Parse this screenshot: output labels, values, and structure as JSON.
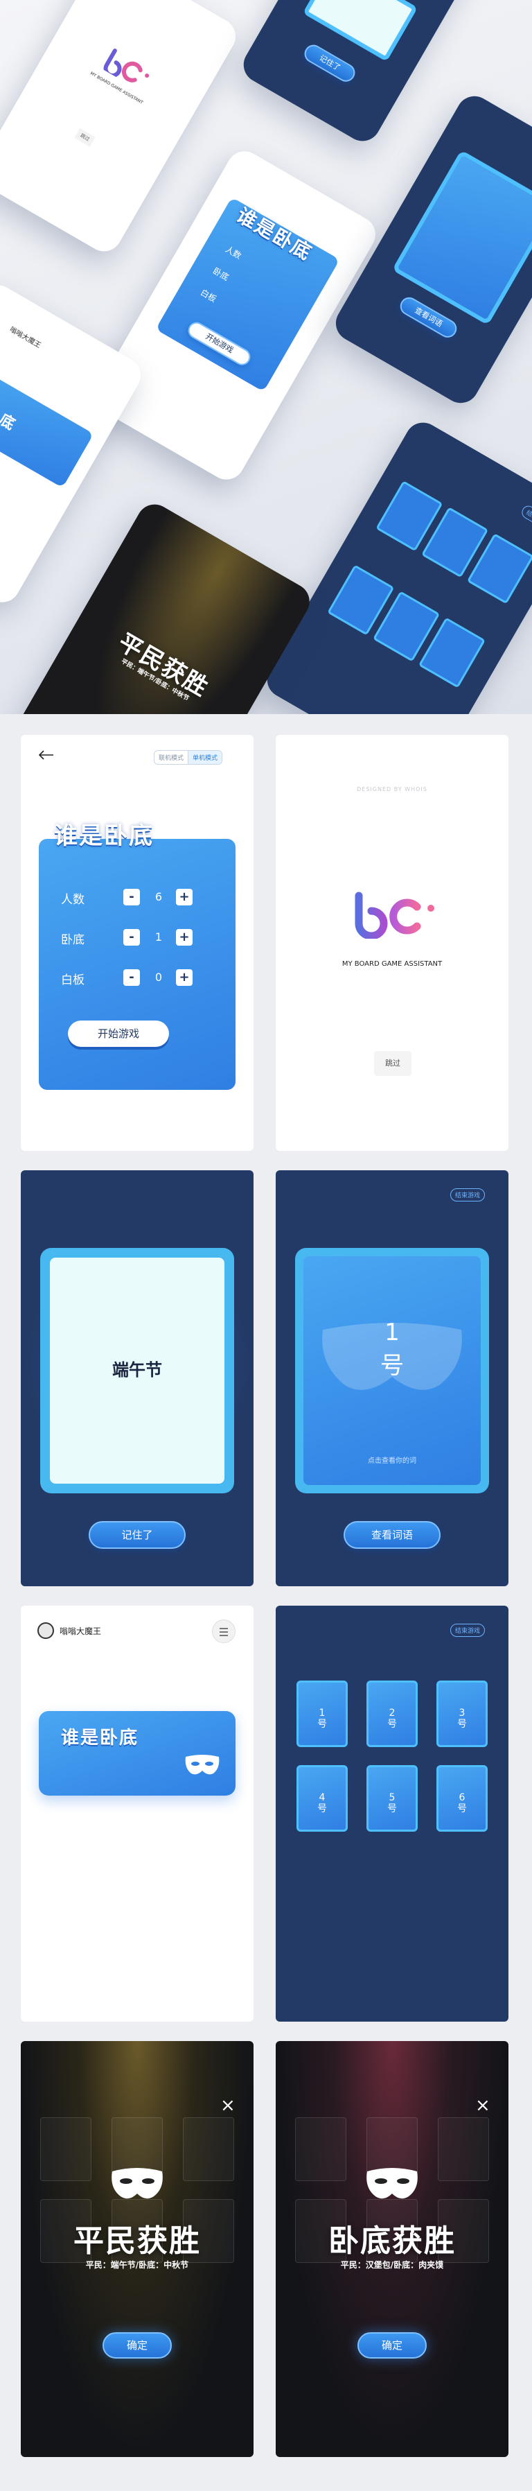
{
  "colors": {
    "navy": "#233a66",
    "blue": "#2f7fe3",
    "cyan": "#4fc0ff",
    "bg": "#eceef2"
  },
  "app": {
    "title": "谁是卧底",
    "tagline": "MY BOARD GAME ASSISTANT",
    "designed_by": "DESIGNED BY WHOIS"
  },
  "mode_tabs": [
    "联机模式",
    "单机模式"
  ],
  "settings": {
    "rows": [
      {
        "label": "人数",
        "minus": "-",
        "value": "6",
        "plus": "+"
      },
      {
        "label": "卧底",
        "minus": "-",
        "value": "1",
        "plus": "+"
      },
      {
        "label": "白板",
        "minus": "-",
        "value": "0",
        "plus": "+"
      }
    ],
    "start_button": "开始游戏"
  },
  "splash": {
    "skip": "跳过"
  },
  "reveal": {
    "word": "端午节",
    "remember_button": "记住了"
  },
  "card": {
    "number": "1",
    "unit": "号",
    "hint": "点击查看你的词",
    "view_button": "查看词语"
  },
  "end_game": "结束游戏",
  "lobby": {
    "username": "嗡嗡大魔王",
    "banner_title": "谁是卧底"
  },
  "players": [
    {
      "num": "1",
      "unit": "号"
    },
    {
      "num": "2",
      "unit": "号"
    },
    {
      "num": "3",
      "unit": "号"
    },
    {
      "num": "4",
      "unit": "号"
    },
    {
      "num": "5",
      "unit": "号"
    },
    {
      "num": "6",
      "unit": "号"
    }
  ],
  "result_civilian": {
    "title": "平民获胜",
    "detail": "平民：端午节/卧底：中秋节",
    "confirm": "确定"
  },
  "result_spy": {
    "title": "卧底获胜",
    "detail": "平民：汉堡包/卧底：肉夹馍",
    "confirm": "确定"
  },
  "icons": {
    "back": "arrow-left-icon",
    "menu": "menu-icon",
    "close": "close-icon",
    "mask": "mask-icon",
    "avatar": "avatar-icon"
  }
}
